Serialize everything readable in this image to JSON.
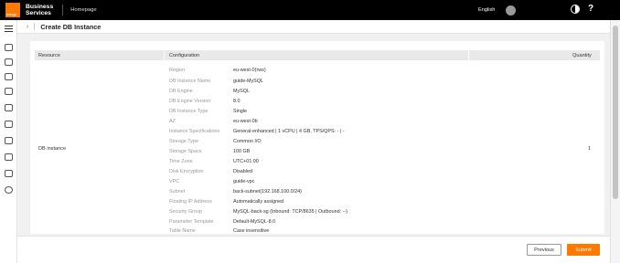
{
  "topbar": {
    "logo_text": "orange",
    "brand_line1": "Business",
    "brand_line2": "Services",
    "home_link": "Homepage",
    "language": "English"
  },
  "header": {
    "title": "Create DB Instance"
  },
  "table": {
    "col_resource": "Resource",
    "col_configuration": "Configuration",
    "col_quantity": "Quantity",
    "resource": "DB instance",
    "quantity": "1",
    "rows": [
      {
        "label": "Region",
        "value": "eu-west-0(rws)"
      },
      {
        "label": "DB Instance Name",
        "value": "guide-MySQL"
      },
      {
        "label": "DB Engine",
        "value": "MySQL"
      },
      {
        "label": "DB Engine Version",
        "value": "8.0"
      },
      {
        "label": "DB Instance Type",
        "value": "Single"
      },
      {
        "label": "AZ",
        "value": "eu-west-0b"
      },
      {
        "label": "Instance Specifications",
        "value": "General-enhanced | 1 vCPU | 4 GB, TPS/QPS: - | -"
      },
      {
        "label": "Storage Type",
        "value": "Common I/O"
      },
      {
        "label": "Storage Space",
        "value": "100 GB"
      },
      {
        "label": "Time Zone",
        "value": "UTC+01:00"
      },
      {
        "label": "Disk Encryption",
        "value": "Disabled"
      },
      {
        "label": "VPC",
        "value": "guide-vpc"
      },
      {
        "label": "Subnet",
        "value": "back-subnet(192.168.100.0/24)"
      },
      {
        "label": "Floating IP Address",
        "value": "Automatically assigned"
      },
      {
        "label": "Security Group",
        "value": "MySQL-back-sg (Inbound: TCP/8635 | Outbound: --)"
      },
      {
        "label": "Parameter Template",
        "value": "Default-MySQL-8.0"
      },
      {
        "label": "Table Name",
        "value": "Case insensitive"
      }
    ]
  },
  "footer": {
    "previous_label": "Previous",
    "submit_label": "Submit"
  },
  "colors": {
    "accent": "#ff7900",
    "topbar": "#000000"
  },
  "icons": {
    "back": "chevron-left-icon",
    "theme": "theme-toggle-icon",
    "help": "help-icon",
    "menu": "hamburger-menu-icon"
  }
}
